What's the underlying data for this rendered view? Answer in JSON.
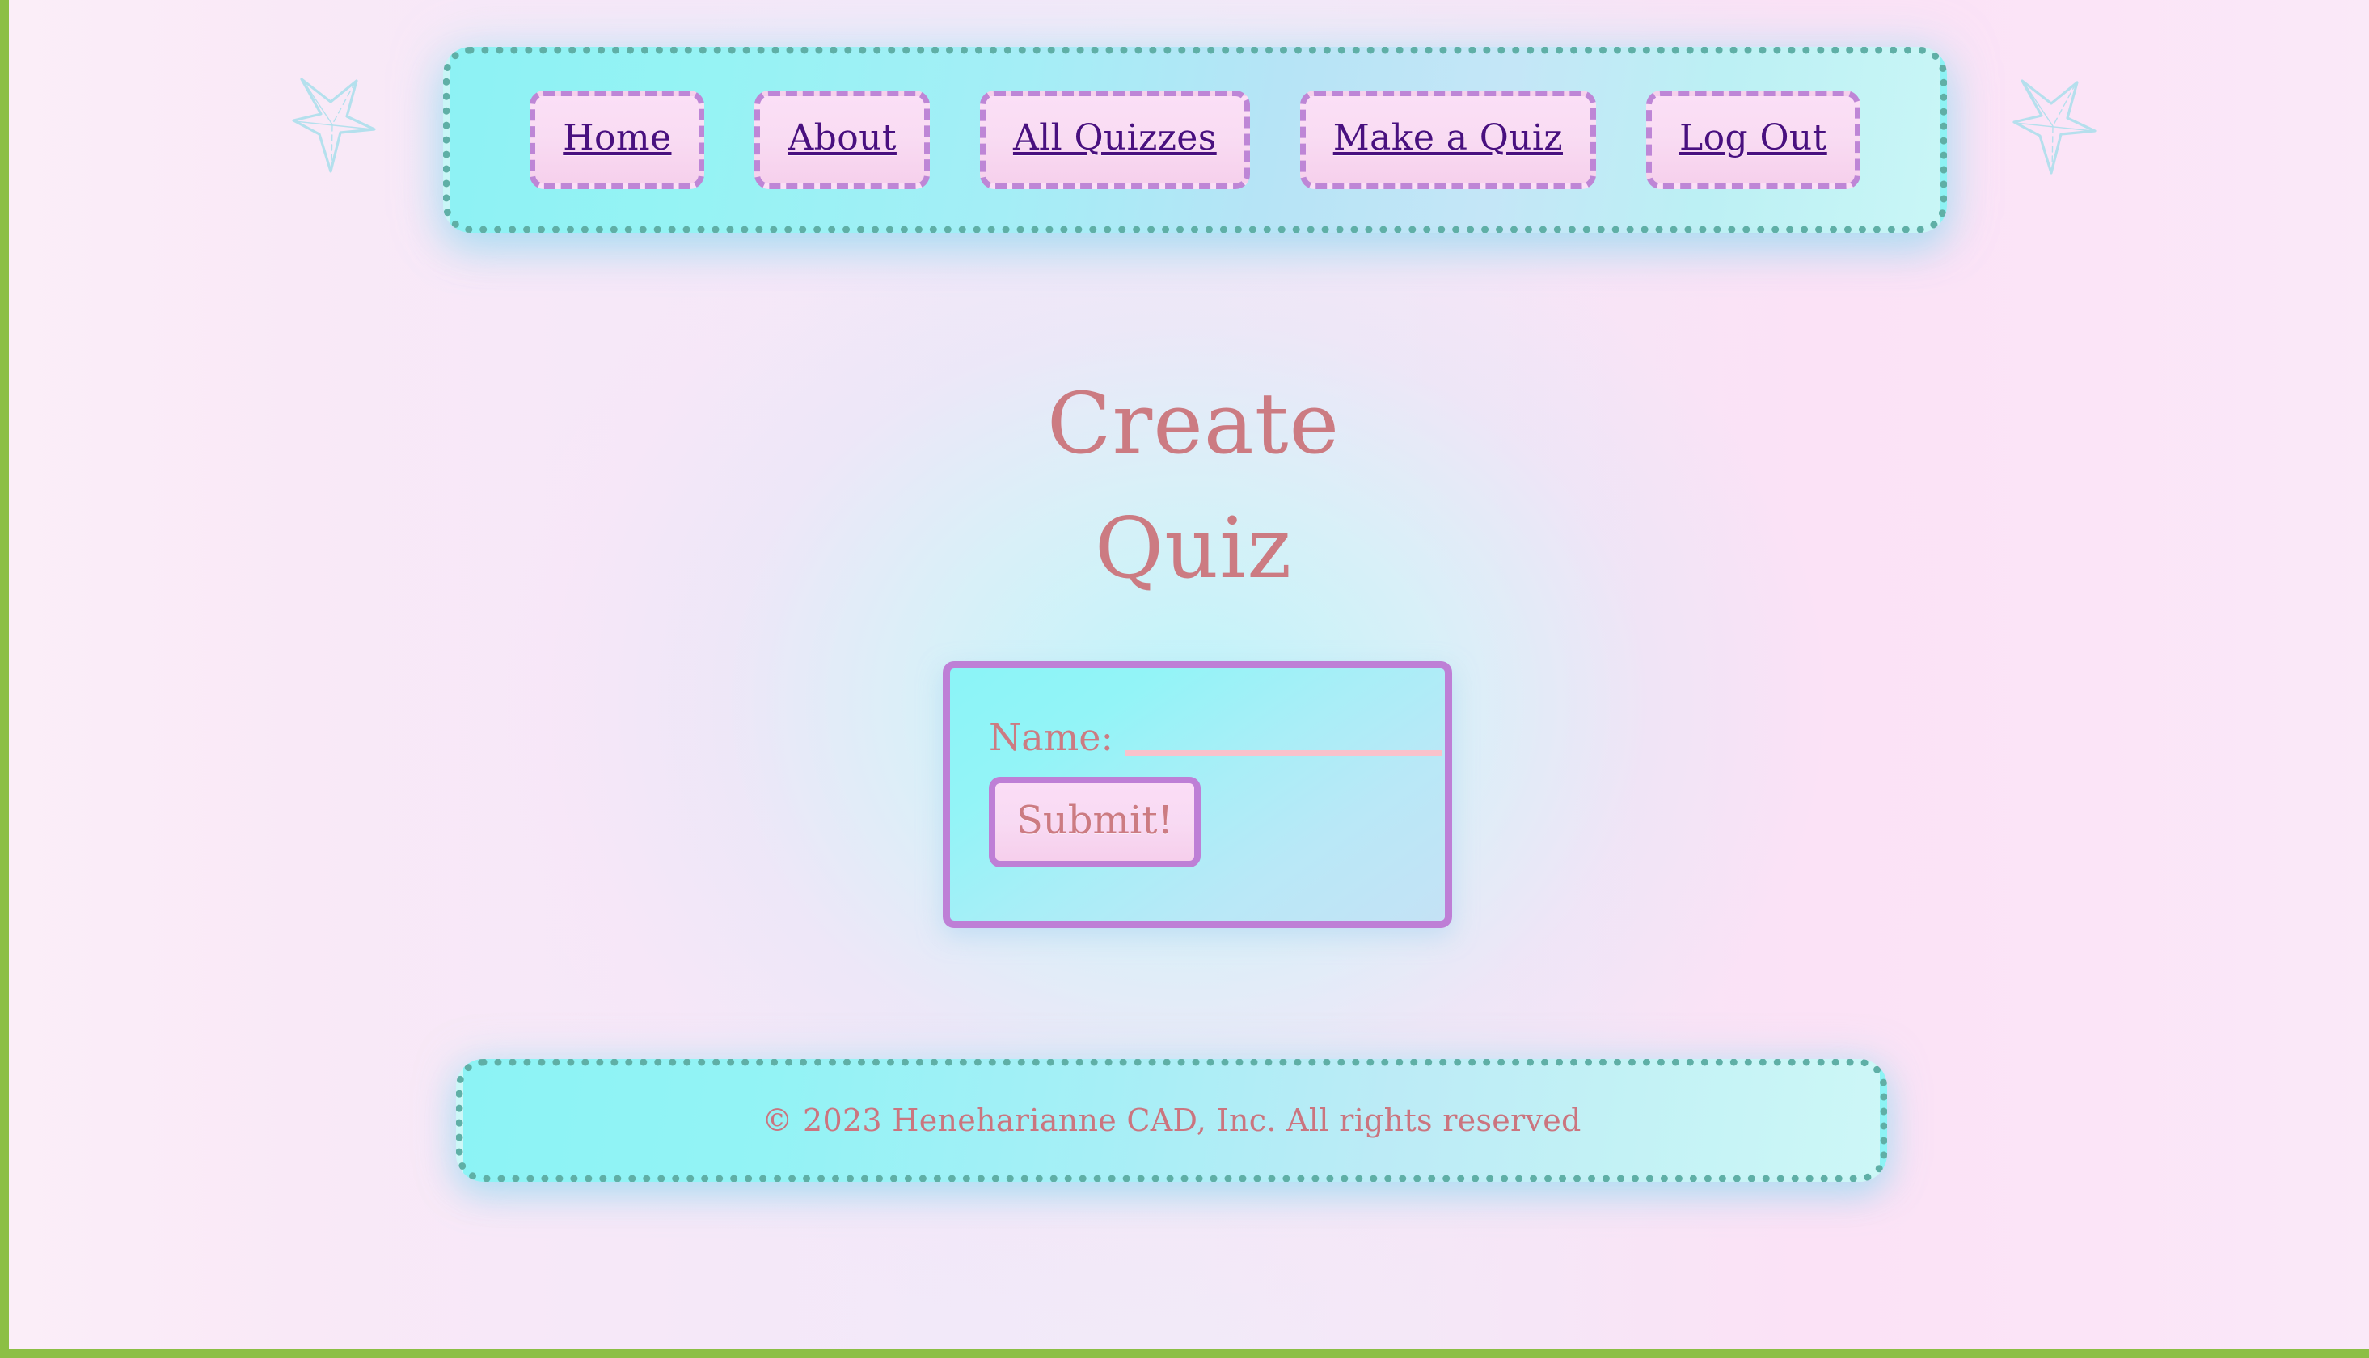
{
  "page": {
    "accent_green": "#8CBF45",
    "accent_teal_dots": "#5FAFA6",
    "accent_purple": "#BE7FD6",
    "accent_rose": "#CC7B82",
    "accent_deep_purple": "#49107F",
    "accent_cyan": "#8DF2F4",
    "accent_pink": "#FBDFF6"
  },
  "nav": {
    "items": [
      {
        "label": "Home"
      },
      {
        "label": "About"
      },
      {
        "label": "All Quizzes"
      },
      {
        "label": "Make a Quiz"
      },
      {
        "label": "Log Out"
      }
    ]
  },
  "decor": {
    "star_left": "star-icon",
    "star_right": "star-icon"
  },
  "main": {
    "title_line1": "Create",
    "title_line2": "Quiz",
    "form": {
      "name_label": "Name:",
      "name_value": "",
      "name_placeholder": "",
      "submit_label": "Submit!"
    }
  },
  "footer": {
    "copyright": "© 2023 Heneharianne CAD, Inc. All rights reserved"
  }
}
